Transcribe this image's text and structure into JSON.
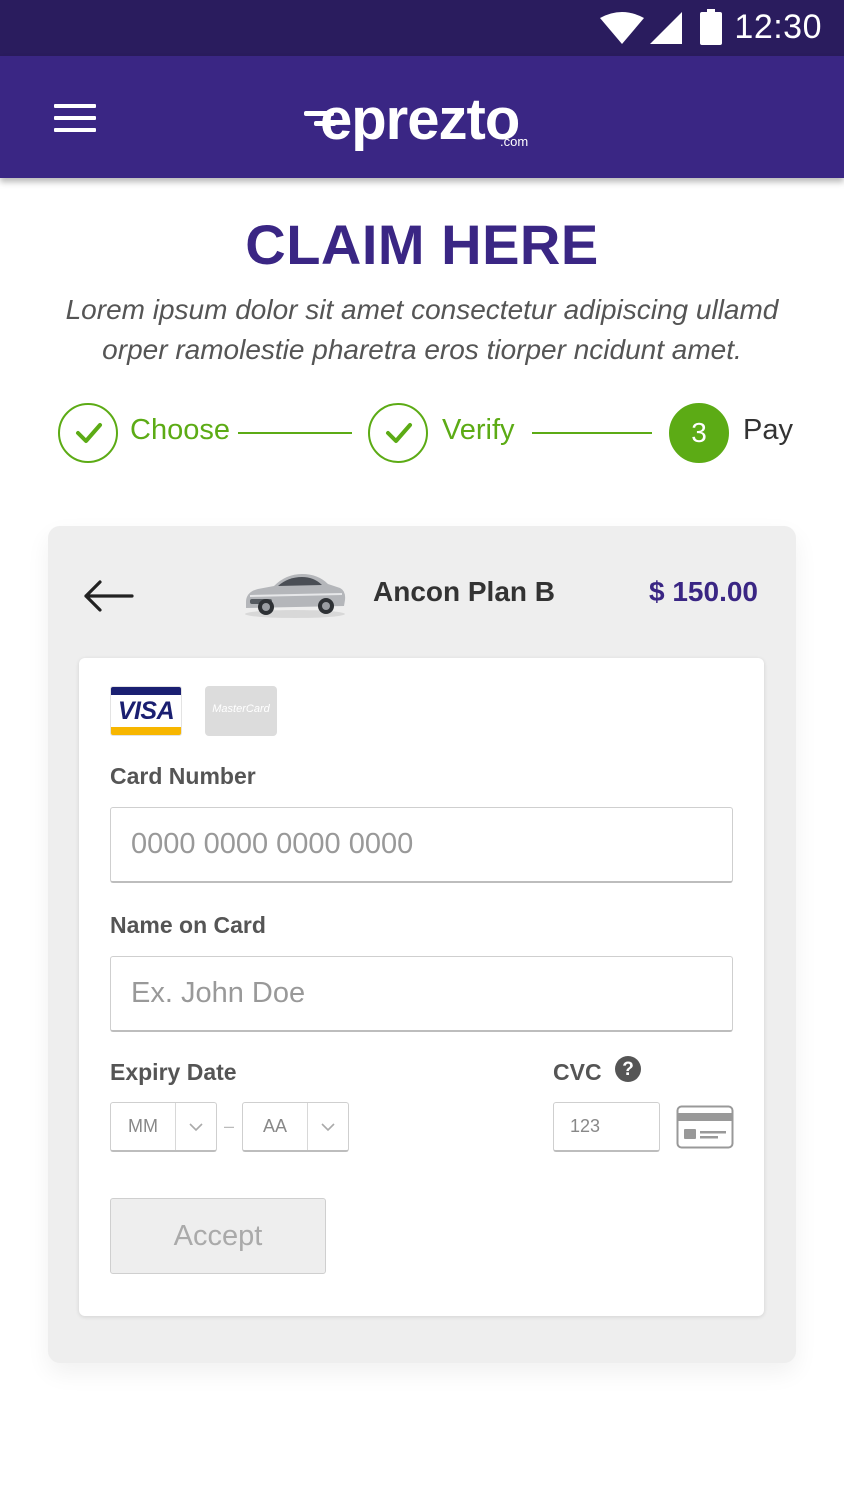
{
  "status_bar": {
    "time": "12:30",
    "icons": [
      "wifi-icon",
      "signal-icon",
      "battery-icon"
    ]
  },
  "app_bar": {
    "brand": "eprezto",
    "brand_suffix": ".com",
    "menu_icon": "hamburger-menu-icon",
    "background_color": "#3a2684"
  },
  "header": {
    "title": "CLAIM HERE",
    "subtitle": "Lorem ipsum dolor sit amet consectetur adipiscing ullamd orper ramolestie pharetra eros tiorper ncidunt amet."
  },
  "stepper": {
    "accent_color": "#5cab15",
    "steps": [
      {
        "label": "Choose",
        "status": "complete"
      },
      {
        "label": "Verify",
        "status": "complete"
      },
      {
        "label": "Pay",
        "status": "current",
        "number": "3"
      }
    ]
  },
  "plan": {
    "name": "Ancon Plan B",
    "price": "$ 150.00",
    "back_icon": "arrow-left-icon",
    "image": "car-icon"
  },
  "payment_form": {
    "card_brands": [
      {
        "name": "VISA",
        "selected": true
      },
      {
        "name": "MasterCard",
        "selected": false
      }
    ],
    "card_number": {
      "label": "Card Number",
      "placeholder": "0000 0000 0000 0000",
      "value": ""
    },
    "name_on_card": {
      "label": "Name on Card",
      "placeholder": "Ex. John Doe",
      "value": ""
    },
    "expiry": {
      "label": "Expiry Date",
      "month": "MM",
      "year": "AA",
      "separator": "–"
    },
    "cvc": {
      "label": "CVC",
      "placeholder": "123",
      "help_icon": "question-circle-icon",
      "card_icon": "card-back-icon"
    },
    "accept_label": "Accept"
  }
}
